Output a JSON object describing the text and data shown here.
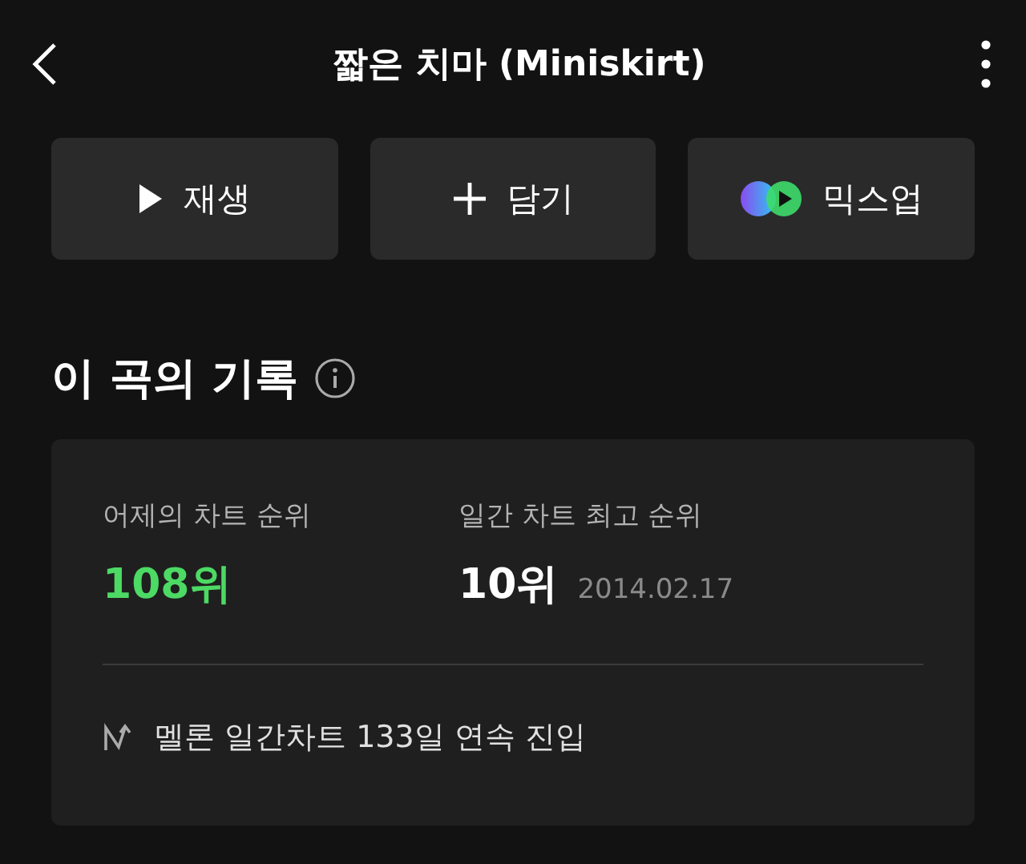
{
  "header": {
    "title": "짧은 치마 (Miniskirt)"
  },
  "actions": [
    {
      "kind": "play",
      "label": "재생"
    },
    {
      "kind": "add",
      "label": "담기"
    },
    {
      "kind": "mixup",
      "label": "믹스업"
    }
  ],
  "section": {
    "title": "이 곡의 기록"
  },
  "stats": [
    {
      "label": "어제의 차트 순위",
      "value": "108위",
      "color": "#4cd964"
    },
    {
      "label": "일간 차트 최고 순위",
      "value": "10위",
      "color": "#ffffff",
      "date": "2014.02.17"
    }
  ],
  "streak": "멜론 일간차트 133일 연속 진입"
}
